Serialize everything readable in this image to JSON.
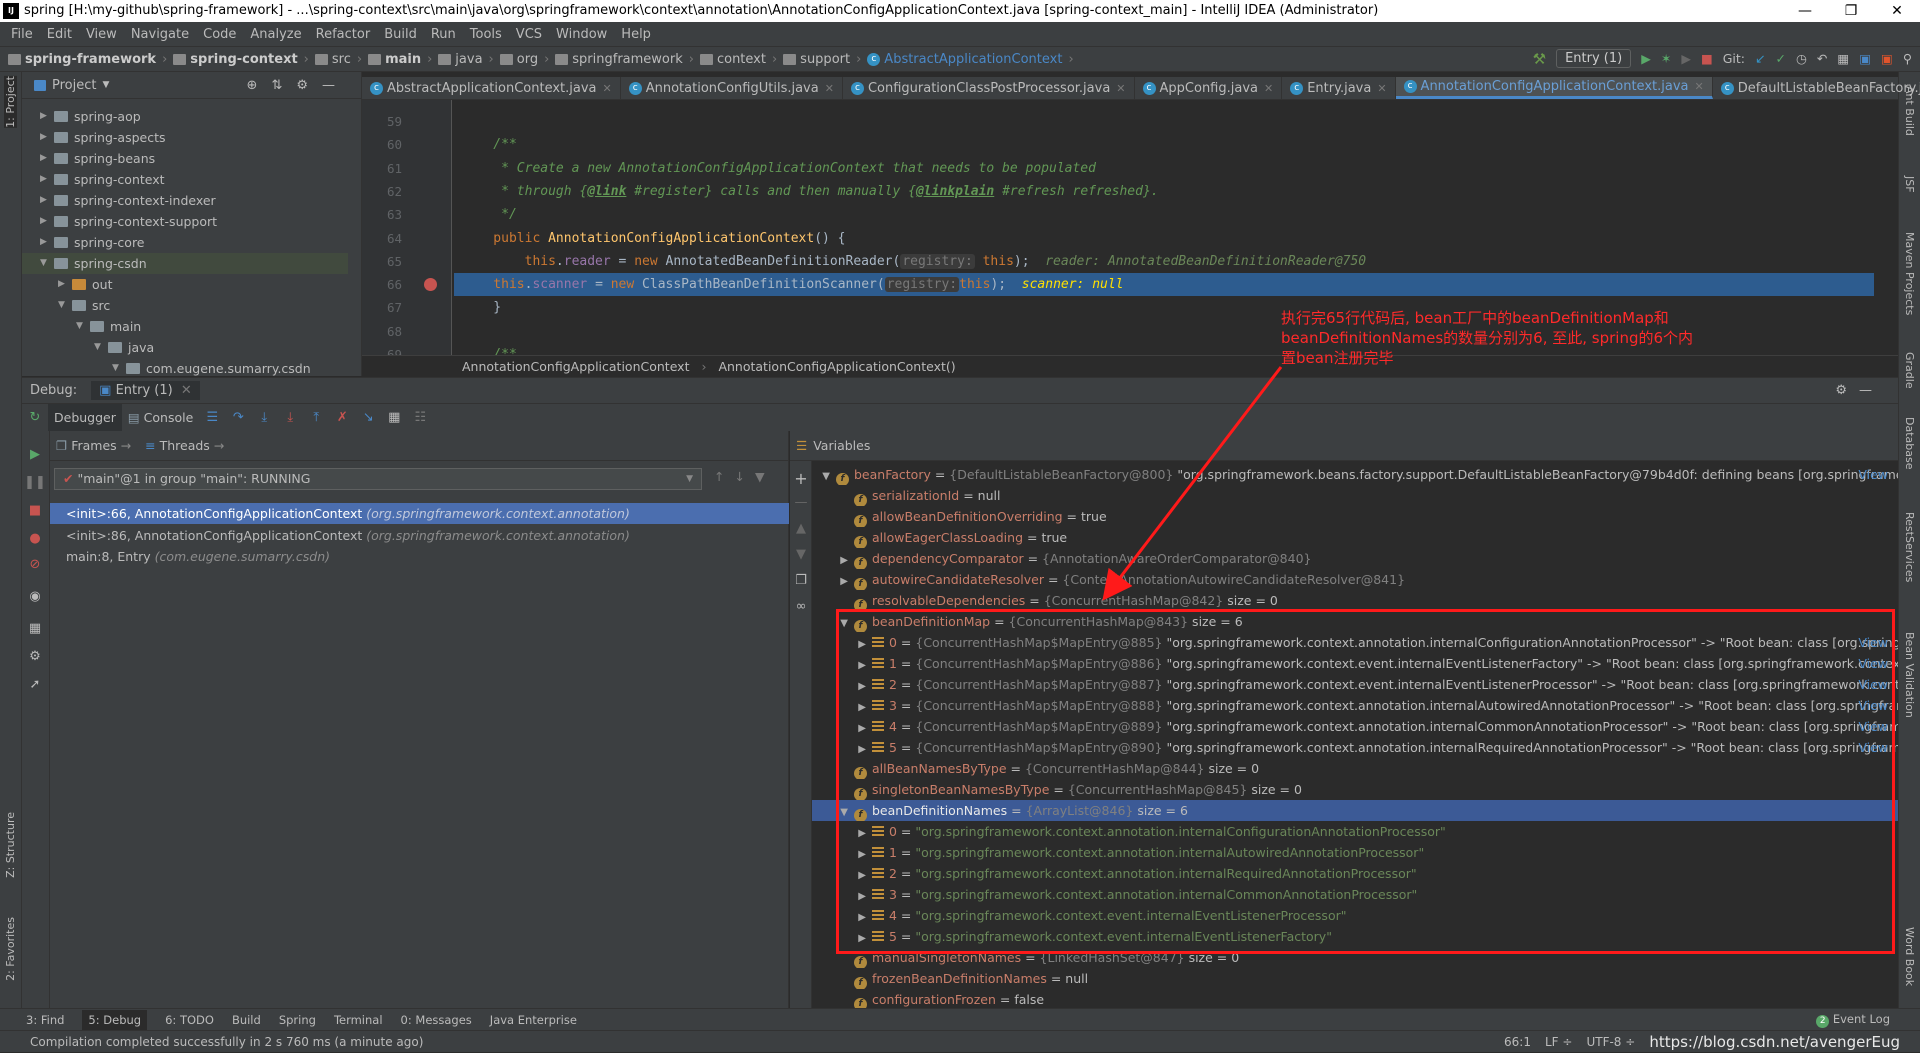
{
  "title": "spring [H:\\my-github\\spring-framework] - ...\\spring-context\\src\\main\\java\\org\\springframework\\context\\annotation\\AnnotationConfigApplicationContext.java [spring-context_main] - IntelliJ IDEA (Administrator)",
  "logo": "IJ",
  "menu": [
    "File",
    "Edit",
    "View",
    "Navigate",
    "Code",
    "Analyze",
    "Refactor",
    "Build",
    "Run",
    "Tools",
    "VCS",
    "Window",
    "Help"
  ],
  "breadcrumb": [
    "spring-framework",
    "spring-context",
    "src",
    "main",
    "java",
    "org",
    "springframework",
    "context",
    "support",
    "AbstractApplicationContext"
  ],
  "run_config": "Entry (1)",
  "git_label": "Git:",
  "project_panel": {
    "title": "Project",
    "items": [
      {
        "label": "spring-aop",
        "depth": 0,
        "open": false
      },
      {
        "label": "spring-aspects",
        "depth": 0,
        "open": false
      },
      {
        "label": "spring-beans",
        "depth": 0,
        "open": false
      },
      {
        "label": "spring-context",
        "depth": 0,
        "open": false
      },
      {
        "label": "spring-context-indexer",
        "depth": 0,
        "open": false
      },
      {
        "label": "spring-context-support",
        "depth": 0,
        "open": false
      },
      {
        "label": "spring-core",
        "depth": 0,
        "open": false
      },
      {
        "label": "spring-csdn",
        "depth": 0,
        "open": true
      },
      {
        "label": "out",
        "depth": 1,
        "open": false,
        "orange": true
      },
      {
        "label": "src",
        "depth": 1,
        "open": true
      },
      {
        "label": "main",
        "depth": 2,
        "open": true
      },
      {
        "label": "java",
        "depth": 3,
        "open": true
      },
      {
        "label": "com.eugene.sumarry.csdn",
        "depth": 4,
        "open": true
      }
    ]
  },
  "tabs": [
    {
      "label": "AbstractApplicationContext.java",
      "active": false
    },
    {
      "label": "AnnotationConfigUtils.java",
      "active": false
    },
    {
      "label": "ConfigurationClassPostProcessor.java",
      "active": false
    },
    {
      "label": "AppConfig.java",
      "active": false
    },
    {
      "label": "Entry.java",
      "active": false
    },
    {
      "label": "AnnotationConfigApplicationContext.java",
      "active": true
    },
    {
      "label": "DefaultListableBeanFactory.java",
      "active": false
    }
  ],
  "tabs_overflow": "3",
  "code": [
    {
      "n": "59",
      "tokens": []
    },
    {
      "n": "60",
      "tokens": [
        {
          "c": "cm",
          "t": "    /**"
        }
      ]
    },
    {
      "n": "61",
      "tokens": [
        {
          "c": "cm",
          "t": "     * Create a new AnnotationConfigApplicationContext that needs to be populated"
        }
      ]
    },
    {
      "n": "62",
      "tokens": [
        {
          "c": "cm",
          "t": "     * through {"
        },
        {
          "c": "tag",
          "t": "@link"
        },
        {
          "c": "cm",
          "t": " #register} calls and then manually {"
        },
        {
          "c": "tag",
          "t": "@linkplain"
        },
        {
          "c": "cm",
          "t": " #refresh refreshed}."
        }
      ]
    },
    {
      "n": "63",
      "tokens": [
        {
          "c": "cm",
          "t": "     */"
        }
      ]
    },
    {
      "n": "64",
      "tokens": [
        {
          "c": "kw",
          "t": "    public "
        },
        {
          "c": "fn",
          "t": "AnnotationConfigApplicationContext"
        },
        {
          "c": "",
          "t": "() {"
        }
      ]
    },
    {
      "n": "65",
      "tokens": [
        {
          "c": "kw",
          "t": "        this"
        },
        {
          "c": "",
          "t": "."
        },
        {
          "c": "fld",
          "t": "reader"
        },
        {
          "c": "",
          "t": " = "
        },
        {
          "c": "kw",
          "t": "new "
        },
        {
          "c": "",
          "t": "AnnotatedBeanDefinitionReader("
        },
        {
          "c": "hint",
          "t": "registry:"
        },
        {
          "c": "kw",
          "t": " this"
        },
        {
          "c": "",
          "t": ");  "
        },
        {
          "c": "inl",
          "t": "reader: AnnotatedBeanDefinitionReader@750"
        }
      ]
    },
    {
      "n": "66",
      "exec": true,
      "tokens": [
        {
          "c": "kw",
          "t": "    this"
        },
        {
          "c": "",
          "t": "."
        },
        {
          "c": "fld",
          "t": "scanner"
        },
        {
          "c": "",
          "t": " = "
        },
        {
          "c": "kw",
          "t": "new "
        },
        {
          "c": "",
          "t": "ClassPathBeanDefinitionScanner("
        },
        {
          "c": "hint",
          "t": "registry:"
        },
        {
          "c": "kw",
          "t": "this"
        },
        {
          "c": "",
          "t": ");  "
        },
        {
          "c": "inly",
          "t": "scanner: null"
        }
      ]
    },
    {
      "n": "67",
      "tokens": [
        {
          "c": "",
          "t": "    }"
        }
      ]
    },
    {
      "n": "68",
      "tokens": []
    },
    {
      "n": "69",
      "tokens": [
        {
          "c": "cm",
          "t": "    /**"
        }
      ]
    }
  ],
  "editor_breadcrumb": [
    "AnnotationConfigApplicationContext",
    "AnnotationConfigApplicationContext()"
  ],
  "annotation_note": "执行完65行代码后, bean工厂中的beanDefinitionMap和beanDefinitionNames的数量分别为6, 至此, spring的6个内置bean注册完毕",
  "debug": {
    "label": "Debug:",
    "session": "Entry (1)",
    "tabs": [
      "Debugger",
      "Console"
    ],
    "frames_tab": "Frames",
    "threads_tab": "Threads",
    "thread": "\"main\"@1 in group \"main\": RUNNING",
    "frames": [
      {
        "method": "<init>:66, AnnotationConfigApplicationContext ",
        "pkg": "(org.springframework.context.annotation)",
        "selected": true
      },
      {
        "method": "<init>:86, AnnotationConfigApplicationContext ",
        "pkg": "(org.springframework.context.annotation)",
        "selected": false
      },
      {
        "method": "main:8, Entry ",
        "pkg": "(com.eugene.sumarry.csdn)",
        "selected": false
      }
    ],
    "variables_title": "Variables",
    "view_link": "View",
    "variables": [
      {
        "d": 0,
        "exp": "open",
        "kind": "f",
        "name": "beanFactory",
        "type": "{DefaultListableBeanFactory@800}",
        "val": " \"org.springframework.beans.factory.support.DefaultListableBeanFactory@79b4d0f: defining beans [org.springframewo...",
        "view": true
      },
      {
        "d": 1,
        "exp": "",
        "kind": "f",
        "name": "serializationId",
        "type": "",
        "val": "null"
      },
      {
        "d": 1,
        "exp": "",
        "kind": "f",
        "name": "allowBeanDefinitionOverriding",
        "type": "",
        "val": "true"
      },
      {
        "d": 1,
        "exp": "",
        "kind": "f",
        "name": "allowEagerClassLoading",
        "type": "",
        "val": "true"
      },
      {
        "d": 1,
        "exp": "closed",
        "kind": "f",
        "name": "dependencyComparator",
        "type": "{AnnotationAwareOrderComparator@840}",
        "val": ""
      },
      {
        "d": 1,
        "exp": "closed",
        "kind": "f",
        "name": "autowireCandidateResolver",
        "type": "{ContextAnnotationAutowireCandidateResolver@841}",
        "val": ""
      },
      {
        "d": 1,
        "exp": "",
        "kind": "f",
        "name": "resolvableDependencies",
        "type": "{ConcurrentHashMap@842}",
        "val": "  size = 0"
      },
      {
        "d": 1,
        "exp": "open",
        "kind": "f",
        "name": "beanDefinitionMap",
        "type": "{ConcurrentHashMap@843}",
        "val": "  size = 6"
      },
      {
        "d": 2,
        "exp": "closed",
        "kind": "e",
        "name": "0",
        "type": "{ConcurrentHashMap$MapEntry@885}",
        "val": " \"org.springframework.context.annotation.internalConfigurationAnnotationProcessor\" -> \"Root bean: class [org.springfra...",
        "view": true
      },
      {
        "d": 2,
        "exp": "closed",
        "kind": "e",
        "name": "1",
        "type": "{ConcurrentHashMap$MapEntry@886}",
        "val": " \"org.springframework.context.event.internalEventListenerFactory\" -> \"Root bean: class [org.springframework.context.ev...",
        "view": true
      },
      {
        "d": 2,
        "exp": "closed",
        "kind": "e",
        "name": "2",
        "type": "{ConcurrentHashMap$MapEntry@887}",
        "val": " \"org.springframework.context.event.internalEventListenerProcessor\" -> \"Root bean: class [org.springframework.context...",
        "view": true
      },
      {
        "d": 2,
        "exp": "closed",
        "kind": "e",
        "name": "3",
        "type": "{ConcurrentHashMap$MapEntry@888}",
        "val": " \"org.springframework.context.annotation.internalAutowiredAnnotationProcessor\" -> \"Root bean: class [org.springframe...",
        "view": true
      },
      {
        "d": 2,
        "exp": "closed",
        "kind": "e",
        "name": "4",
        "type": "{ConcurrentHashMap$MapEntry@889}",
        "val": " \"org.springframework.context.annotation.internalCommonAnnotationProcessor\" -> \"Root bean: class [org.springframew...",
        "view": true
      },
      {
        "d": 2,
        "exp": "closed",
        "kind": "e",
        "name": "5",
        "type": "{ConcurrentHashMap$MapEntry@890}",
        "val": " \"org.springframework.context.annotation.internalRequiredAnnotationProcessor\" -> \"Root bean: class [org.springframew...",
        "view": true
      },
      {
        "d": 1,
        "exp": "",
        "kind": "f",
        "name": "allBeanNamesByType",
        "type": "{ConcurrentHashMap@844}",
        "val": "  size = 0"
      },
      {
        "d": 1,
        "exp": "",
        "kind": "f",
        "name": "singletonBeanNamesByType",
        "type": "{ConcurrentHashMap@845}",
        "val": "  size = 0"
      },
      {
        "d": 1,
        "exp": "open",
        "kind": "f",
        "name": "beanDefinitionNames",
        "type": "{ArrayList@846}",
        "val": "  size = 6",
        "selected": true
      },
      {
        "d": 2,
        "exp": "closed",
        "kind": "e",
        "name": "0",
        "type": "",
        "str": "\"org.springframework.context.annotation.internalConfigurationAnnotationProcessor\""
      },
      {
        "d": 2,
        "exp": "closed",
        "kind": "e",
        "name": "1",
        "type": "",
        "str": "\"org.springframework.context.annotation.internalAutowiredAnnotationProcessor\""
      },
      {
        "d": 2,
        "exp": "closed",
        "kind": "e",
        "name": "2",
        "type": "",
        "str": "\"org.springframework.context.annotation.internalRequiredAnnotationProcessor\""
      },
      {
        "d": 2,
        "exp": "closed",
        "kind": "e",
        "name": "3",
        "type": "",
        "str": "\"org.springframework.context.annotation.internalCommonAnnotationProcessor\""
      },
      {
        "d": 2,
        "exp": "closed",
        "kind": "e",
        "name": "4",
        "type": "",
        "str": "\"org.springframework.context.event.internalEventListenerProcessor\""
      },
      {
        "d": 2,
        "exp": "closed",
        "kind": "e",
        "name": "5",
        "type": "",
        "str": "\"org.springframework.context.event.internalEventListenerFactory\""
      },
      {
        "d": 1,
        "exp": "",
        "kind": "f",
        "name": "manualSingletonNames",
        "type": "{LinkedHashSet@847}",
        "val": "  size = 0"
      },
      {
        "d": 1,
        "exp": "",
        "kind": "f",
        "name": "frozenBeanDefinitionNames",
        "type": "",
        "val": "null"
      },
      {
        "d": 1,
        "exp": "",
        "kind": "f",
        "name": "configurationFrozen",
        "type": "",
        "val": "false"
      }
    ]
  },
  "left_stripe": [
    "1: Project",
    "Z: Structure",
    "2: Favorites"
  ],
  "right_stripe": [
    "Ant Build",
    "JSF",
    "Maven Projects",
    "Gradle",
    "Database",
    "RestServices",
    "Bean Validation",
    "Word Book"
  ],
  "bottom_tools": [
    "3: Find",
    "5: Debug",
    "6: TODO",
    "Build",
    "Spring",
    "Terminal",
    "0: Messages",
    "Java Enterprise"
  ],
  "event_log": "Event Log",
  "event_count": "2",
  "status": {
    "message": "Compilation completed successfully in 2 s 760 ms (a minute ago)",
    "position": "66:1",
    "line_sep": "LF ÷",
    "encoding": "UTF-8 ÷"
  },
  "watermark": "https://blog.csdn.net/avengerEug",
  "colors": {
    "accent": "#4a88c7",
    "annotation": "#ff1a1a",
    "exec_line": "#2d5c8f",
    "selection": "#4b6eaf"
  }
}
